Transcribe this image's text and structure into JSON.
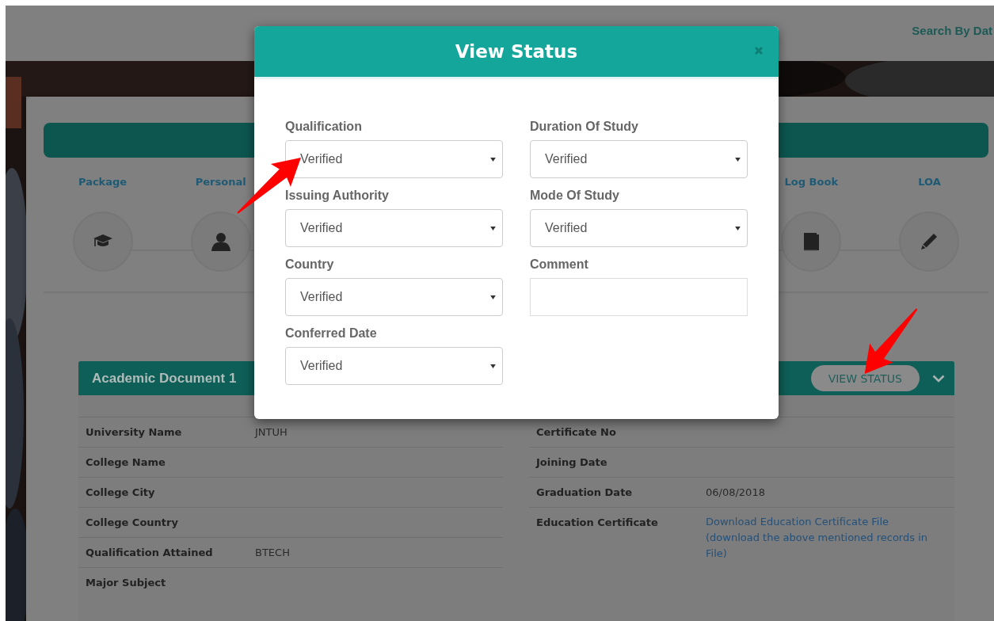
{
  "header": {
    "search_link": "Search By Dat"
  },
  "steps": [
    {
      "label": "Package",
      "kind": "cap"
    },
    {
      "label": "Personal",
      "kind": "person"
    },
    {
      "label": "Log Book",
      "kind": "book"
    },
    {
      "label": "LOA",
      "kind": "pencil"
    }
  ],
  "section": {
    "title": "Academic Document 1",
    "button": "VIEW STATUS"
  },
  "details": {
    "left": [
      {
        "label": "University Name",
        "value": "JNTUH"
      },
      {
        "label": "College Name"
      },
      {
        "label": "College City"
      },
      {
        "label": "College Country"
      },
      {
        "label": "Qualification Attained",
        "value": "BTECH"
      },
      {
        "label": "Major Subject"
      }
    ],
    "right": [
      {
        "label": "Certificate No"
      },
      {
        "label": "Joining Date"
      },
      {
        "label": "Graduation Date",
        "value": "06/08/2018"
      },
      {
        "label": "Education Certificate",
        "value": "Download Education Certificate File (download the above mentioned records in File)",
        "kind": "link"
      }
    ]
  },
  "modal": {
    "title": "View Status",
    "left_fields": [
      {
        "label": "Qualification",
        "kind": "select",
        "value": "Verified"
      },
      {
        "label": "Issuing Authority",
        "kind": "select",
        "value": "Verified"
      },
      {
        "label": "Country",
        "kind": "select",
        "value": "Verified"
      },
      {
        "label": "Conferred Date",
        "kind": "select",
        "value": "Verified"
      }
    ],
    "right_fields": [
      {
        "label": "Duration Of Study",
        "kind": "select",
        "value": "Verified"
      },
      {
        "label": "Mode Of Study",
        "kind": "select",
        "value": "Verified"
      },
      {
        "label": "Comment",
        "kind": "textarea"
      }
    ]
  },
  "callouts": [
    {
      "kind": "arrow"
    },
    {
      "kind": "arrow"
    }
  ]
}
